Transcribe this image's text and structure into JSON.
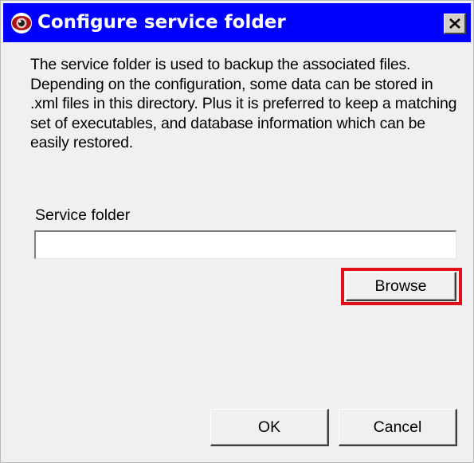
{
  "window": {
    "title": "Configure service folder",
    "close_icon": "close-icon",
    "app_icon": "eye-icon",
    "title_bar_color": "#0000ff"
  },
  "content": {
    "description": "The service folder is used to backup the associated files.  Depending on the configuration, some data can be stored in .xml files in this directory.  Plus it is preferred to keep a matching set of executables, and database information which can be easily restored.",
    "folder_label": "Service folder",
    "folder_value": ""
  },
  "buttons": {
    "browse": "Browse",
    "ok": "OK",
    "cancel": "Cancel"
  },
  "highlight": {
    "target": "browse-button",
    "color": "#e0101a"
  }
}
